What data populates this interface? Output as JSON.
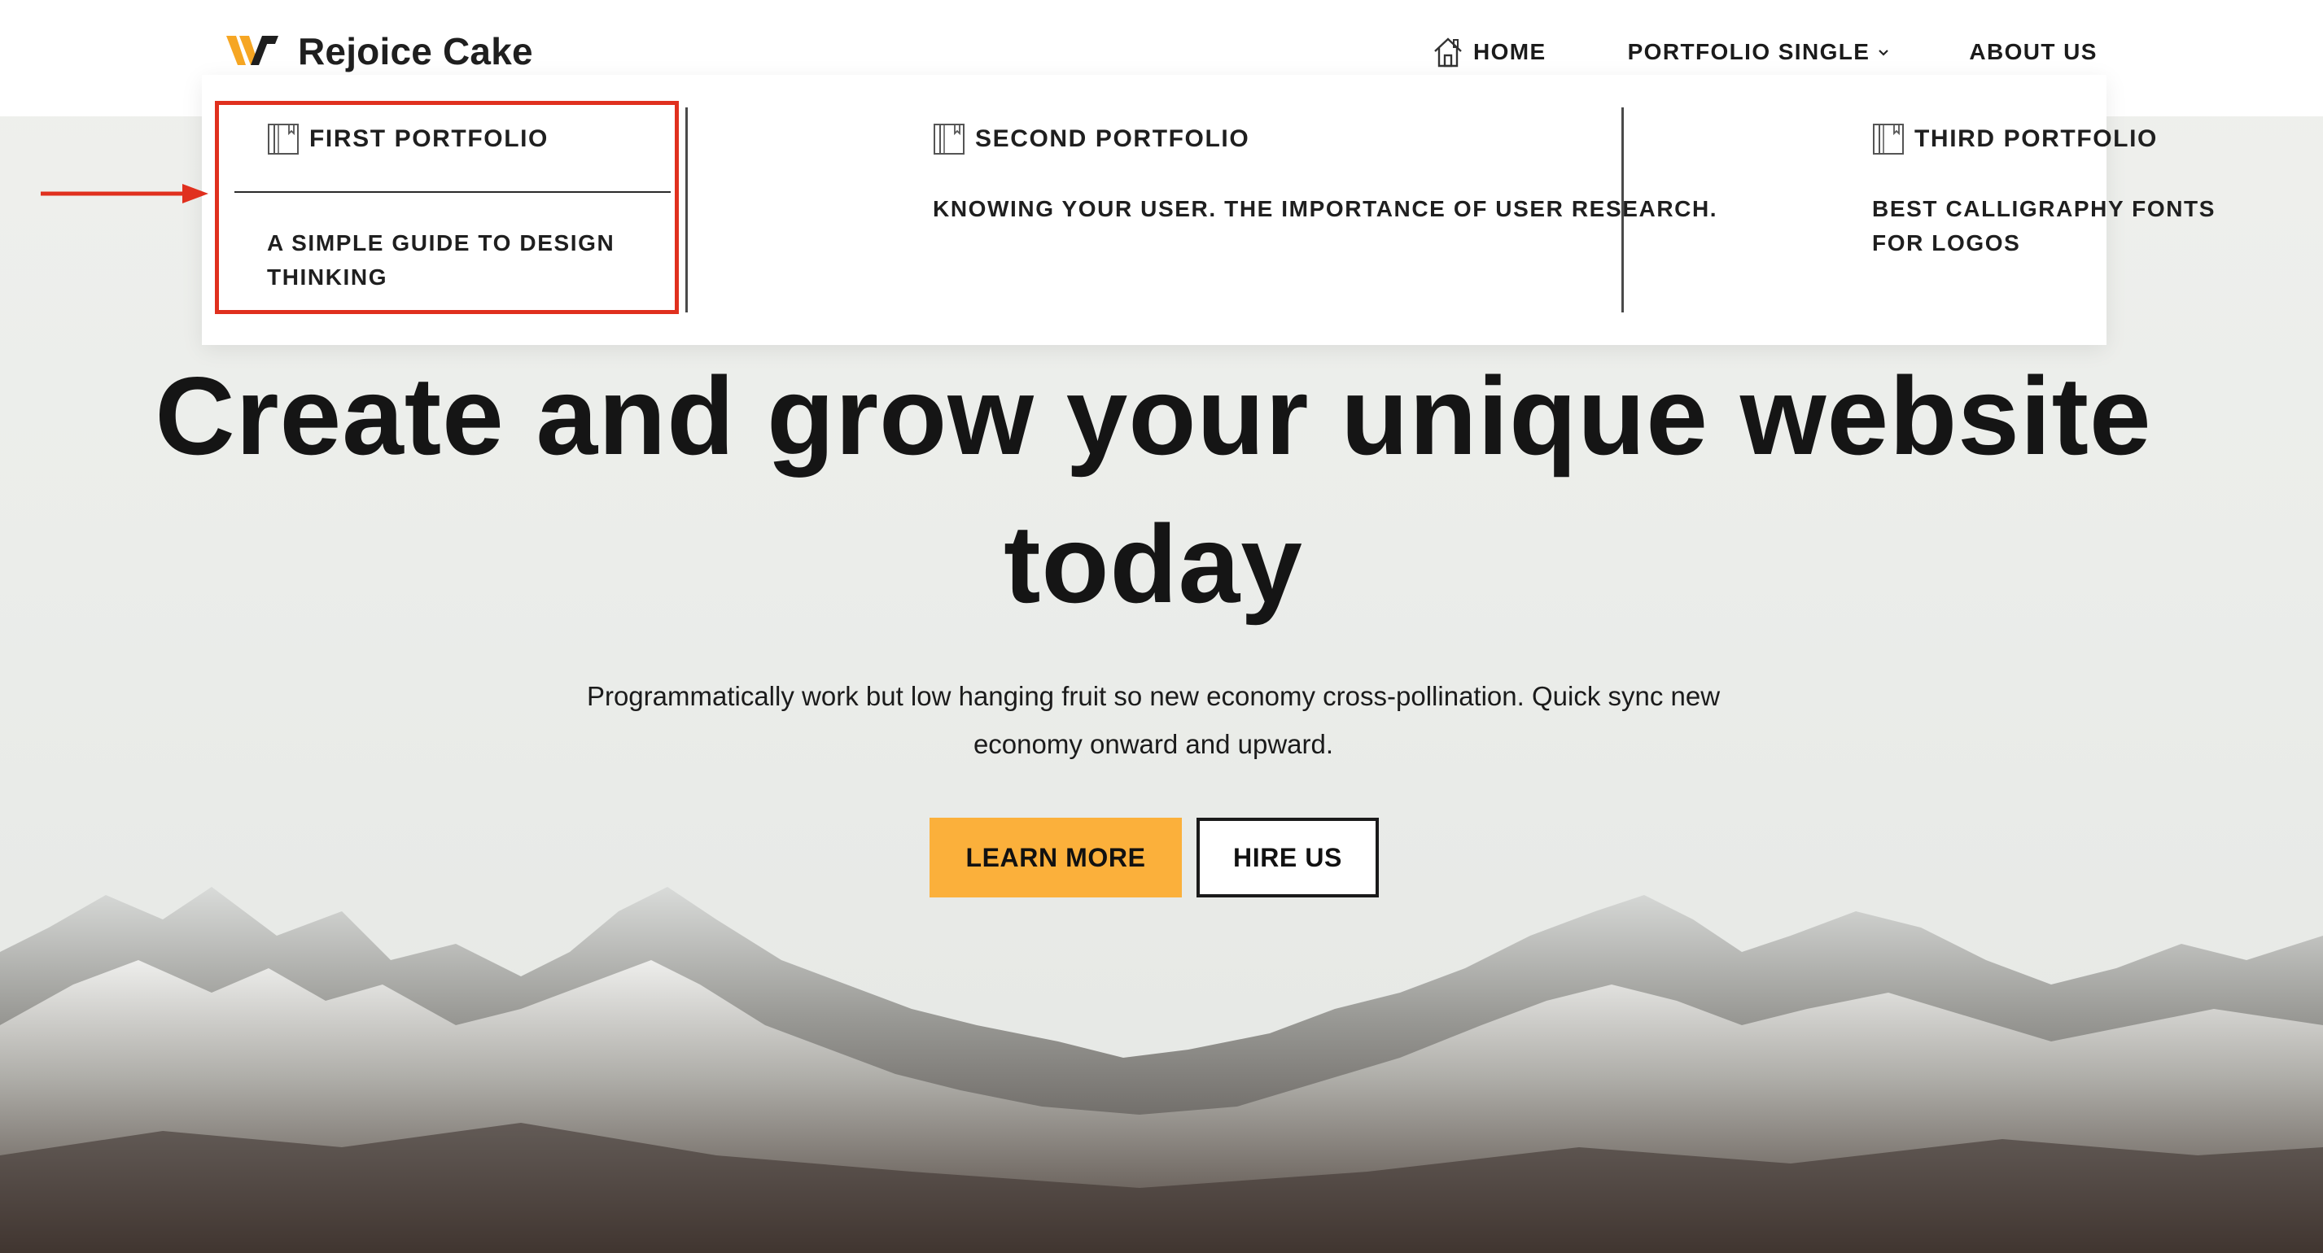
{
  "brand": {
    "name": "Rejoice Cake",
    "accent": "#fbb03b"
  },
  "nav": {
    "home": "HOME",
    "portfolio_single": "PORTFOLIO SINGLE",
    "about": "ABOUT US"
  },
  "mega_menu": {
    "columns": [
      {
        "heading": "FIRST PORTFOLIO",
        "link": "A SIMPLE GUIDE TO DESIGN THINKING",
        "highlighted": true
      },
      {
        "heading": "SECOND PORTFOLIO",
        "link": "KNOWING YOUR USER. THE IMPORTANCE OF USER RESEARCH."
      },
      {
        "heading": "THIRD PORTFOLIO",
        "link": "BEST CALLIGRAPHY FONTS FOR LOGOS"
      }
    ],
    "annotation_color": "#e0301e"
  },
  "hero": {
    "title": "Create and grow your unique website today",
    "subtitle": "Programmatically work but low hanging fruit so new economy cross-pollination. Quick sync new economy onward and upward.",
    "primary_button": "LEARN MORE",
    "secondary_button": "HIRE US"
  }
}
